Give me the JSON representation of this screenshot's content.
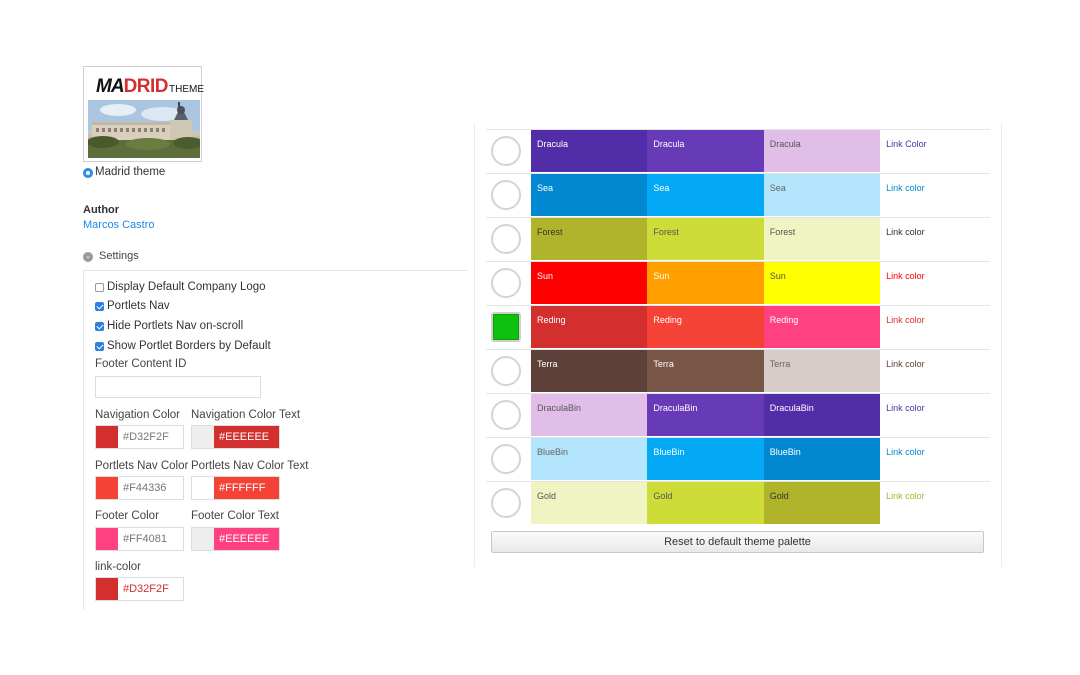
{
  "theme": {
    "logo_m": "MA",
    "logo_rid": "DRID",
    "logo_theme": "THEME",
    "name": "Madrid theme"
  },
  "author": {
    "label": "Author",
    "name": "Marcos Castro"
  },
  "settings": {
    "label": "Settings",
    "checkboxes": [
      {
        "label": "Display Default Company Logo",
        "checked": false
      },
      {
        "label": "Portlets Nav",
        "checked": true
      },
      {
        "label": "Hide Portlets Nav on-scroll",
        "checked": true
      },
      {
        "label": "Show Portlet Borders by Default",
        "checked": true
      }
    ],
    "footer_content_id": {
      "label": "Footer Content ID",
      "value": ""
    },
    "colors": {
      "navigation_color": {
        "label": "Navigation Color",
        "value": "#D32F2F",
        "swatch": "#D32F2F"
      },
      "navigation_color_text": {
        "label": "Navigation Color Text",
        "value": "#EEEEEE",
        "swatch": "#EEEEEE",
        "bg": "#D32F2F"
      },
      "portlets_nav_color": {
        "label": "Portlets Nav Color",
        "value": "#F44336",
        "swatch": "#F44336"
      },
      "portlets_nav_color_text": {
        "label": "Portlets Nav Color Text",
        "value": "#FFFFFF",
        "swatch": "#FFFFFF",
        "bg": "#F44336"
      },
      "footer_color": {
        "label": "Footer Color",
        "value": "#FF4081",
        "swatch": "#FF4081"
      },
      "footer_color_text": {
        "label": "Footer Color Text",
        "value": "#EEEEEE",
        "swatch": "#EEEEEE",
        "bg": "#FF4081"
      },
      "link_color": {
        "label": "link-color",
        "value": "#D32F2F",
        "swatch": "#D32F2F"
      }
    }
  },
  "palettes": [
    {
      "selected": false,
      "cells": [
        {
          "label": "Dracula",
          "bg": "#512DA8",
          "fg": "#FFFFFF"
        },
        {
          "label": "Dracula",
          "bg": "#673AB7",
          "fg": "#FFFFFF"
        },
        {
          "label": "Dracula",
          "bg": "#E1BEE7",
          "fg": "#555555"
        }
      ],
      "link": {
        "label": "Link Color",
        "fg": "#512DA8"
      }
    },
    {
      "selected": false,
      "cells": [
        {
          "label": "Sea",
          "bg": "#0288D1",
          "fg": "#FFFFFF"
        },
        {
          "label": "Sea",
          "bg": "#03A9F4",
          "fg": "#FFFFFF"
        },
        {
          "label": "Sea",
          "bg": "#B3E5FC",
          "fg": "#666666"
        }
      ],
      "link": {
        "label": "Link color",
        "fg": "#0288D1"
      }
    },
    {
      "selected": false,
      "cells": [
        {
          "label": "Forest",
          "bg": "#AFB42B",
          "fg": "#333333"
        },
        {
          "label": "Forest",
          "bg": "#CDDC39",
          "fg": "#555555"
        },
        {
          "label": "Forest",
          "bg": "#F0F4C3",
          "fg": "#555555"
        }
      ],
      "link": {
        "label": "Link color",
        "fg": "#333333"
      }
    },
    {
      "selected": false,
      "cells": [
        {
          "label": "Sun",
          "bg": "#FF0000",
          "fg": "#FFFFFF"
        },
        {
          "label": "Sun",
          "bg": "#FFA000",
          "fg": "#FFFFFF"
        },
        {
          "label": "Sun",
          "bg": "#FFFF00",
          "fg": "#555555"
        }
      ],
      "link": {
        "label": "Link color",
        "fg": "#FF0000"
      }
    },
    {
      "selected": true,
      "cells": [
        {
          "label": "Reding",
          "bg": "#D32F2F",
          "fg": "#FFFFFF"
        },
        {
          "label": "Reding",
          "bg": "#F44336",
          "fg": "#FFFFFF"
        },
        {
          "label": "Reding",
          "bg": "#FF4081",
          "fg": "#FFFFFF"
        }
      ],
      "link": {
        "label": "Link color",
        "fg": "#D32F2F"
      }
    },
    {
      "selected": false,
      "cells": [
        {
          "label": "Terra",
          "bg": "#5D4037",
          "fg": "#FFFFFF"
        },
        {
          "label": "Terra",
          "bg": "#795548",
          "fg": "#FFFFFF"
        },
        {
          "label": "Terra",
          "bg": "#D7CCC8",
          "fg": "#666666"
        }
      ],
      "link": {
        "label": "Link color",
        "fg": "#5D4037"
      }
    },
    {
      "selected": false,
      "cells": [
        {
          "label": "DraculaBin",
          "bg": "#E1BEE7",
          "fg": "#555555"
        },
        {
          "label": "DraculaBin",
          "bg": "#673AB7",
          "fg": "#FFFFFF"
        },
        {
          "label": "DraculaBin",
          "bg": "#512DA8",
          "fg": "#FFFFFF"
        }
      ],
      "link": {
        "label": "Link color",
        "fg": "#512DA8"
      }
    },
    {
      "selected": false,
      "cells": [
        {
          "label": "BlueBin",
          "bg": "#B3E5FC",
          "fg": "#666666"
        },
        {
          "label": "BlueBin",
          "bg": "#03A9F4",
          "fg": "#FFFFFF"
        },
        {
          "label": "BlueBin",
          "bg": "#0288D1",
          "fg": "#FFFFFF"
        }
      ],
      "link": {
        "label": "Link color",
        "fg": "#0288D1"
      }
    },
    {
      "selected": false,
      "cells": [
        {
          "label": "Gold",
          "bg": "#F0F4C3",
          "fg": "#555555"
        },
        {
          "label": "Gold",
          "bg": "#CDDC39",
          "fg": "#555555"
        },
        {
          "label": "Gold",
          "bg": "#AFB42B",
          "fg": "#333333"
        }
      ],
      "link": {
        "label": "Link color",
        "fg": "#AFB42B"
      }
    }
  ],
  "reset_button": "Reset to default theme palette"
}
